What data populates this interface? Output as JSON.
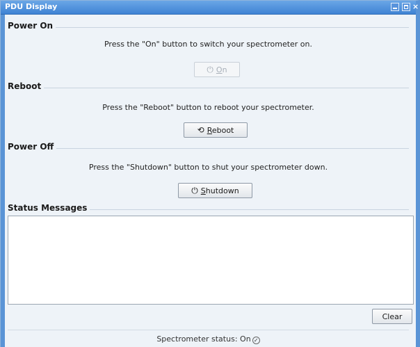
{
  "window": {
    "title": "PDU Display",
    "close_glyph": "×"
  },
  "sections": {
    "power_on": {
      "title": "Power On",
      "description": "Press the \"On\" button to switch your spectrometer on.",
      "button": {
        "icon": "power-icon",
        "glyph": "⏻",
        "label": "On",
        "enabled": false
      }
    },
    "reboot": {
      "title": "Reboot",
      "description": "Press the \"Reboot\" button to reboot your spectrometer.",
      "button": {
        "icon": "reboot-icon",
        "glyph": "⟲",
        "label": "Reboot",
        "enabled": true
      }
    },
    "power_off": {
      "title": "Power Off",
      "description": "Press the \"Shutdown\" button to shut your spectrometer down.",
      "button": {
        "icon": "power-icon",
        "glyph": "⏻",
        "label": "Shutdown",
        "enabled": true
      }
    },
    "status_messages": {
      "title": "Status Messages",
      "messages": [],
      "clear_label": "Clear"
    }
  },
  "footer": {
    "status_label": "Spectrometer status:",
    "status_value": "On",
    "status_icon": "check-circle-icon",
    "status_glyph": "✓"
  },
  "colors": {
    "titlebar": "#3f83d4",
    "window_frame": "#5a94d6",
    "background": "#eef3f8"
  }
}
